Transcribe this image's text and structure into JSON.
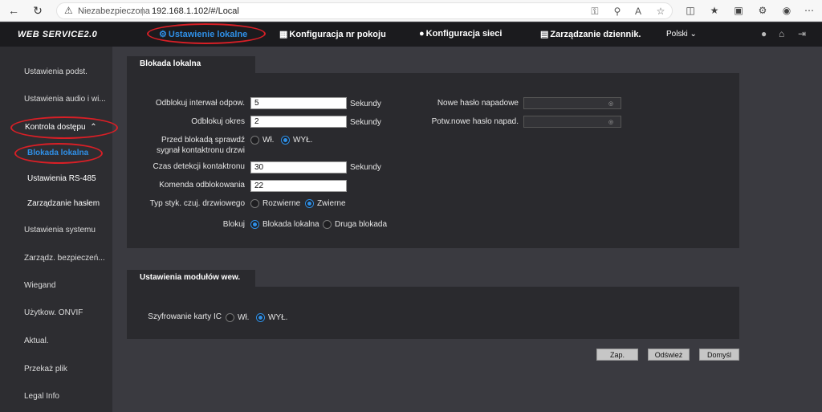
{
  "browser": {
    "insecure_label": "Niezabezpieczona",
    "separator": "|",
    "url": "192.168.1.102/#/Local"
  },
  "header": {
    "logo": "WEB SERVICE2.0",
    "menu": [
      {
        "label": "Ustawienie lokalne",
        "icon": "gear-icon"
      },
      {
        "label": "Konfiguracja nr pokoju",
        "icon": "building-icon"
      },
      {
        "label": "Konfiguracja sieci",
        "icon": "globe-icon"
      },
      {
        "label": "Zarządzanie dziennik.",
        "icon": "log-icon"
      }
    ],
    "language": "Polski"
  },
  "sidebar": {
    "items": [
      "Ustawienia podst.",
      "Ustawienia audio i wi...",
      "Kontrola dostępu",
      "Blokada lokalna",
      "Ustawienia RS-485",
      "Zarządzanie hasłem",
      "Ustawienia systemu",
      "Zarządz. bezpieczeń...",
      "Wiegand",
      "Użytkow. ONVIF",
      "Aktual.",
      "Przekaż plik",
      "Legal Info"
    ]
  },
  "lock_panel": {
    "title": "Blokada lokalna",
    "unlock_interval_label": "Odblokuj interwał odpow.",
    "unlock_interval_value": "5",
    "unlock_period_label": "Odblokuj okres",
    "unlock_period_value": "2",
    "seconds": "Sekundy",
    "check_contact_label": "Przed blokadą sprawdź sygnał kontaktronu drzwi",
    "on": "Wł.",
    "off": "WYŁ.",
    "detection_time_label": "Czas detekcji kontaktronu",
    "detection_time_value": "30",
    "unlock_command_label": "Komenda odblokowania",
    "unlock_command_value": "22",
    "door_contact_type_label": "Typ styk. czuj. drzwiowego",
    "nc": "Rozwierne",
    "no": "Zwierne",
    "lock_label": "Blokuj",
    "local_lock": "Blokada lokalna",
    "second_lock": "Druga blokada",
    "duress_pwd_label": "Nowe hasło napadowe",
    "confirm_duress_pwd_label": "Potw.nowe hasło napad."
  },
  "module_panel": {
    "title": "Ustawienia modułów wew.",
    "ic_encryption_label": "Szyfrowanie karty IC",
    "on": "Wł.",
    "off": "WYŁ."
  },
  "buttons": {
    "save": "Zap.",
    "refresh": "Odśwież",
    "default": "Domyśl"
  }
}
